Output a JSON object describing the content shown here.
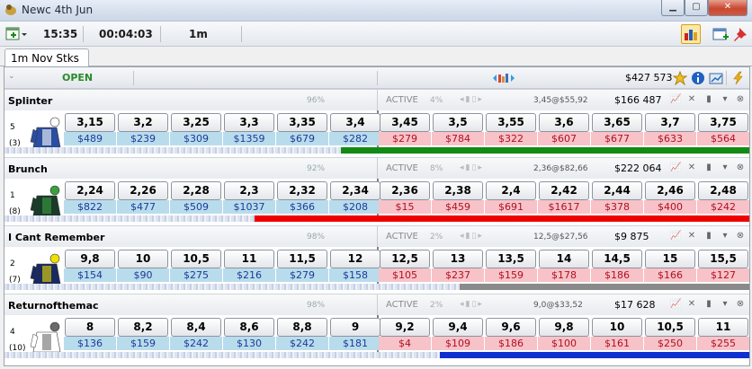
{
  "window": {
    "title": "Newc 4th Jun"
  },
  "toolbar": {
    "time": "15:35",
    "countdown": "00:04:03",
    "distance": "1m"
  },
  "tab": {
    "label": "1m Nov Stks"
  },
  "market": {
    "status": "OPEN",
    "total_matched": "$427 573"
  },
  "selections": [
    {
      "name": "Splinter",
      "number": "5",
      "draw": "(3)",
      "pct": "96%",
      "active": "ACTIVE",
      "bpct": "4%",
      "info": "3,45@$55,92",
      "matched": "$166 487",
      "silk_colors": [
        "#2a4ea0",
        "#ffffff"
      ],
      "back_prices": [
        "3,15",
        "3,2",
        "3,25",
        "3,3",
        "3,35",
        "3,4"
      ],
      "back_vols": [
        "$489",
        "$239",
        "$309",
        "$1359",
        "$679",
        "$282"
      ],
      "lay_prices": [
        "3,45",
        "3,5",
        "3,55",
        "3,6",
        "3,65",
        "3,7",
        "3,75"
      ],
      "lay_vols": [
        "$279",
        "$784",
        "$322",
        "$607",
        "$677",
        "$633",
        "$564"
      ],
      "bar_color": "#138a13"
    },
    {
      "name": "Brunch",
      "number": "1",
      "draw": "(8)",
      "pct": "92%",
      "active": "ACTIVE",
      "bpct": "8%",
      "info": "2,36@$82,66",
      "matched": "$222 064",
      "silk_colors": [
        "#1a3a2a",
        "#3aa040"
      ],
      "back_prices": [
        "2,24",
        "2,26",
        "2,28",
        "2,3",
        "2,32",
        "2,34"
      ],
      "back_vols": [
        "$822",
        "$477",
        "$509",
        "$1037",
        "$366",
        "$208"
      ],
      "lay_prices": [
        "2,36",
        "2,38",
        "2,4",
        "2,42",
        "2,44",
        "2,46",
        "2,48"
      ],
      "lay_vols": [
        "$15",
        "$459",
        "$691",
        "$1617",
        "$378",
        "$400",
        "$242"
      ],
      "bar_color": "#ee0000"
    },
    {
      "name": "I Cant Remember",
      "number": "2",
      "draw": "(7)",
      "pct": "98%",
      "active": "ACTIVE",
      "bpct": "2%",
      "info": "12,5@$27,56",
      "matched": "$9 875",
      "silk_colors": [
        "#1a2a60",
        "#f0e000"
      ],
      "back_prices": [
        "9,8",
        "10",
        "10,5",
        "11",
        "11,5",
        "12"
      ],
      "back_vols": [
        "$154",
        "$90",
        "$275",
        "$216",
        "$279",
        "$158"
      ],
      "lay_prices": [
        "12,5",
        "13",
        "13,5",
        "14",
        "14,5",
        "15",
        "15,5"
      ],
      "lay_vols": [
        "$105",
        "$237",
        "$159",
        "$178",
        "$186",
        "$166",
        "$127"
      ],
      "bar_color": "#8a8a8a"
    },
    {
      "name": "Returnofthemac",
      "number": "4",
      "draw": "(10)",
      "pct": "98%",
      "active": "ACTIVE",
      "bpct": "2%",
      "info": "9,0@$33,52",
      "matched": "$17 628",
      "silk_colors": [
        "#ffffff",
        "#6a6a6a"
      ],
      "back_prices": [
        "8",
        "8,2",
        "8,4",
        "8,6",
        "8,8",
        "9"
      ],
      "back_vols": [
        "$136",
        "$159",
        "$242",
        "$130",
        "$242",
        "$181"
      ],
      "lay_prices": [
        "9,2",
        "9,4",
        "9,6",
        "9,8",
        "10",
        "10,5",
        "11"
      ],
      "lay_vols": [
        "$4",
        "$109",
        "$186",
        "$100",
        "$161",
        "$250",
        "$255"
      ],
      "bar_color": "#1030d0"
    }
  ],
  "colors": {
    "back": "#b9dcec",
    "lay": "#f7c2c8",
    "open": "#2a8a2a"
  },
  "icons": [
    "app-icon",
    "add-icon",
    "chart-icon",
    "new-window-icon",
    "pin-icon",
    "star-icon",
    "info-icon",
    "graph-icon",
    "lightning-icon"
  ]
}
